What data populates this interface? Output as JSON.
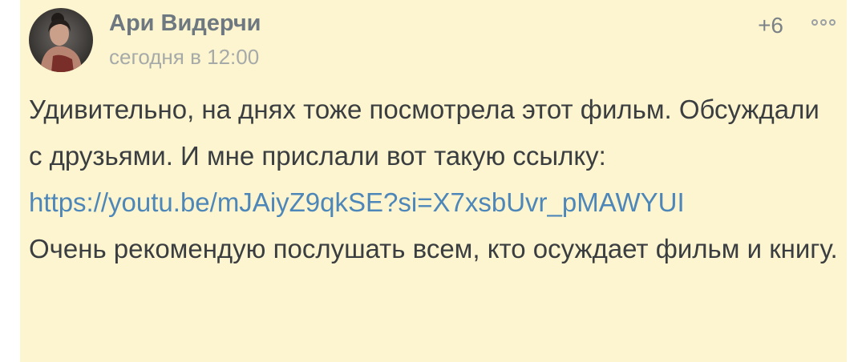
{
  "comment": {
    "author": {
      "name": "Ари Видерчи",
      "avatar_icon": "user-avatar-photo"
    },
    "timestamp": "сегодня в 12:00",
    "rating": "+6",
    "menu_icon": "more-options-icon",
    "body": {
      "text_before_link": "Удивительно, на днях тоже посмотрела этот фильм. Обсуждали с друзьями. И мне прислали вот такую ссылку:",
      "link": "https://youtu.be/mJAiyZ9qkSE?si=X7xsbUvr_pMAWYUI",
      "text_after_link": "Очень рекомендую послушать всем, кто осуждает фильм и книгу."
    }
  },
  "colors": {
    "card_background": "#fdf5cf",
    "author_name": "#6e7880",
    "timestamp": "#a6aaa9",
    "body_text": "#3b3e40",
    "link": "#4d87b9"
  }
}
